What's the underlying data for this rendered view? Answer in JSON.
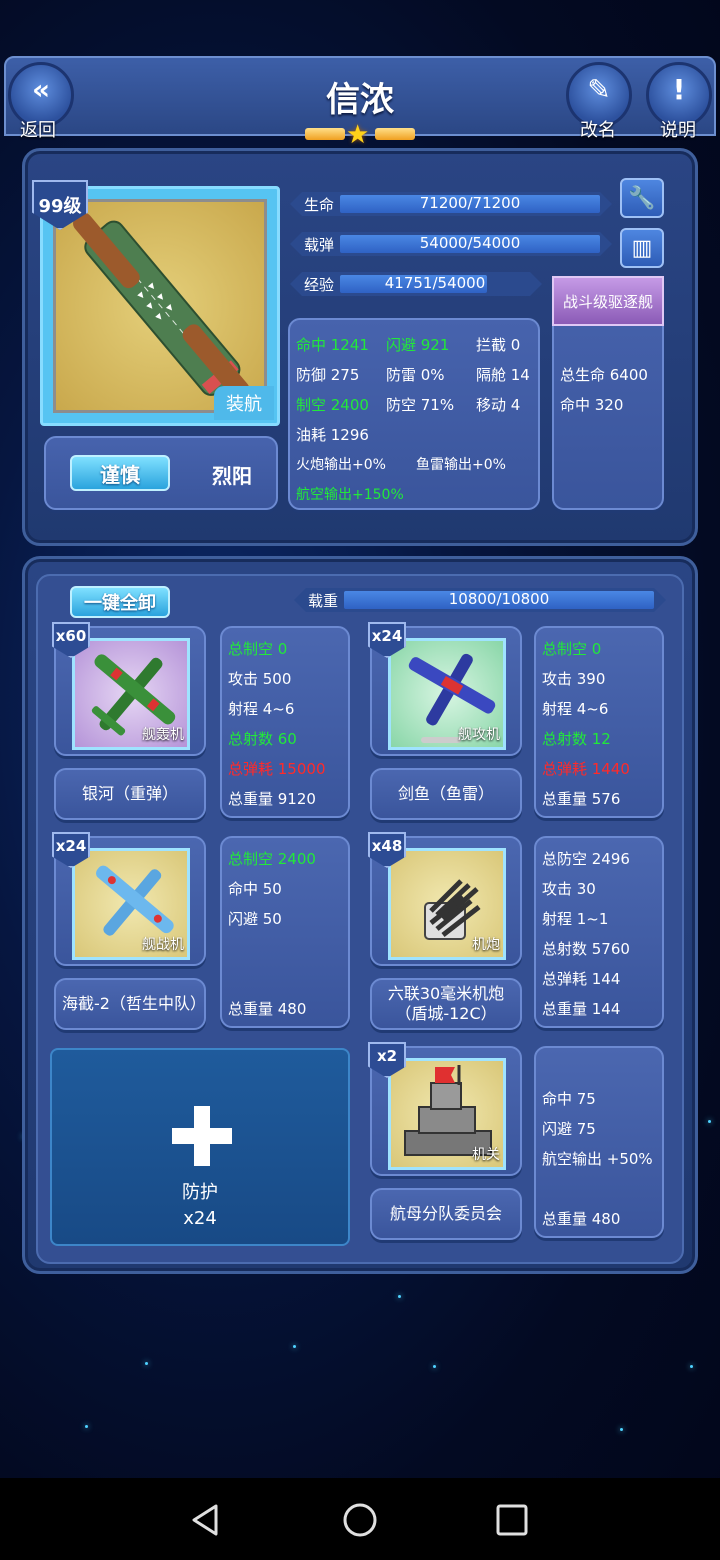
{
  "header": {
    "title": "信浓",
    "back_label": "返回",
    "rename_label": "改名",
    "help_label": "说明"
  },
  "ship": {
    "level": "99级",
    "type": "装航",
    "hp_label": "生命",
    "hp_value": "71200/71200",
    "ammo_label": "载弹",
    "ammo_value": "54000/54000",
    "exp_label": "经验",
    "exp_value": "41751/54000",
    "exp_progress": 0.773,
    "role": "战斗级驱逐舰",
    "skill_btn": "谨慎",
    "skill_text": "烈阳"
  },
  "stats": {
    "hit": "命中 1241",
    "evade": "闪避 921",
    "intercept": "拦截 0",
    "defense": "防御 275",
    "torp_def": "防雷 0%",
    "bulkhead": "隔舱 14",
    "air_control": "制空 2400",
    "aa_def": "防空 71%",
    "move": "移动 4",
    "fuel": "油耗 1296",
    "gun_out": "火炮输出+0%",
    "torp_out": "鱼雷输出+0%",
    "air_out": "航空输出+150%"
  },
  "bonus": {
    "total_hp": "总生命 6400",
    "hit": "命中 320"
  },
  "equip": {
    "unload_btn": "一键全卸",
    "load_label": "载重",
    "load_value": "10800/10800",
    "items": [
      {
        "count": "x60",
        "cat": "舰轰机",
        "name": "银河（重弹）",
        "stats": [
          "总制空 0",
          "攻击 500",
          "射程 4~6",
          "总射数 60",
          "总弹耗 15000",
          "总重量 9120"
        ]
      },
      {
        "count": "x24",
        "cat": "舰攻机",
        "name": "剑鱼（鱼雷）",
        "stats": [
          "总制空 0",
          "攻击 390",
          "射程 4~6",
          "总射数 12",
          "总弹耗 1440",
          "总重量 576"
        ]
      },
      {
        "count": "x24",
        "cat": "舰战机",
        "name": "海截-2（哲生中队）",
        "stats": [
          "总制空 2400",
          "命中 50",
          "闪避 50",
          "总重量 480"
        ]
      },
      {
        "count": "x48",
        "cat": "机炮",
        "name": "六联30毫米机炮（盾城-12C）",
        "stats": [
          "总防空 2496",
          "攻击 30",
          "射程 1~1",
          "总射数 5760",
          "总弹耗 144",
          "总重量 144"
        ]
      },
      {
        "count": "x2",
        "cat": "机关",
        "name": "航母分队委员会",
        "stats": [
          "命中 75",
          "闪避 75",
          "航空输出 +50%",
          "总重量 480"
        ]
      }
    ],
    "add_label": "防护",
    "add_count": "x24"
  },
  "colors": {
    "good": "#22e83a",
    "bad": "#ff2a2a",
    "accent": "#2aa3dd"
  }
}
